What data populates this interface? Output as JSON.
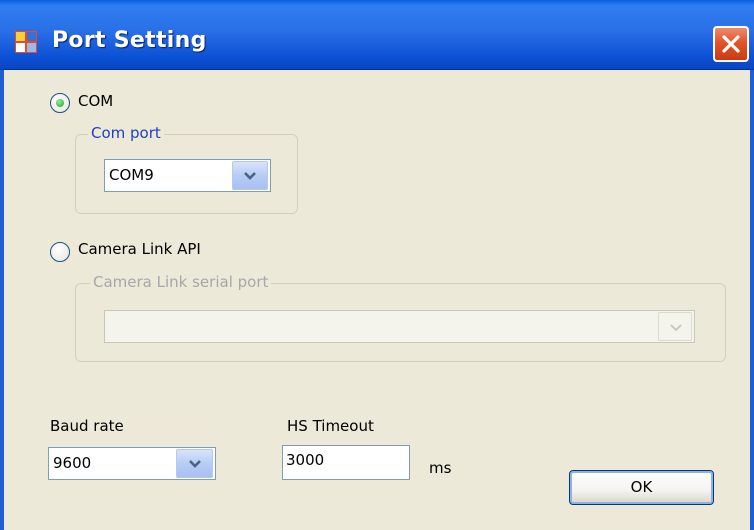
{
  "window": {
    "title": "Port Setting",
    "icon": "app-window-icon",
    "close_icon": "close-icon"
  },
  "com_option": {
    "label": "COM",
    "selected": true,
    "group_label": "Com port",
    "port_value": "COM9"
  },
  "cameralink_option": {
    "label": "Camera Link API",
    "selected": false,
    "group_label": "Camera Link serial port",
    "port_value": ""
  },
  "baud": {
    "label": "Baud rate",
    "value": "9600"
  },
  "timeout": {
    "label": "HS Timeout",
    "value": "3000",
    "unit": "ms"
  },
  "buttons": {
    "ok_label": "OK"
  },
  "colors": {
    "title_bar": "#2a6fe6",
    "dialog_bg": "#ece9d8",
    "group_legend": "#1f3fbf",
    "disabled_text": "#a7a6aa",
    "close_button": "#e2542a"
  }
}
